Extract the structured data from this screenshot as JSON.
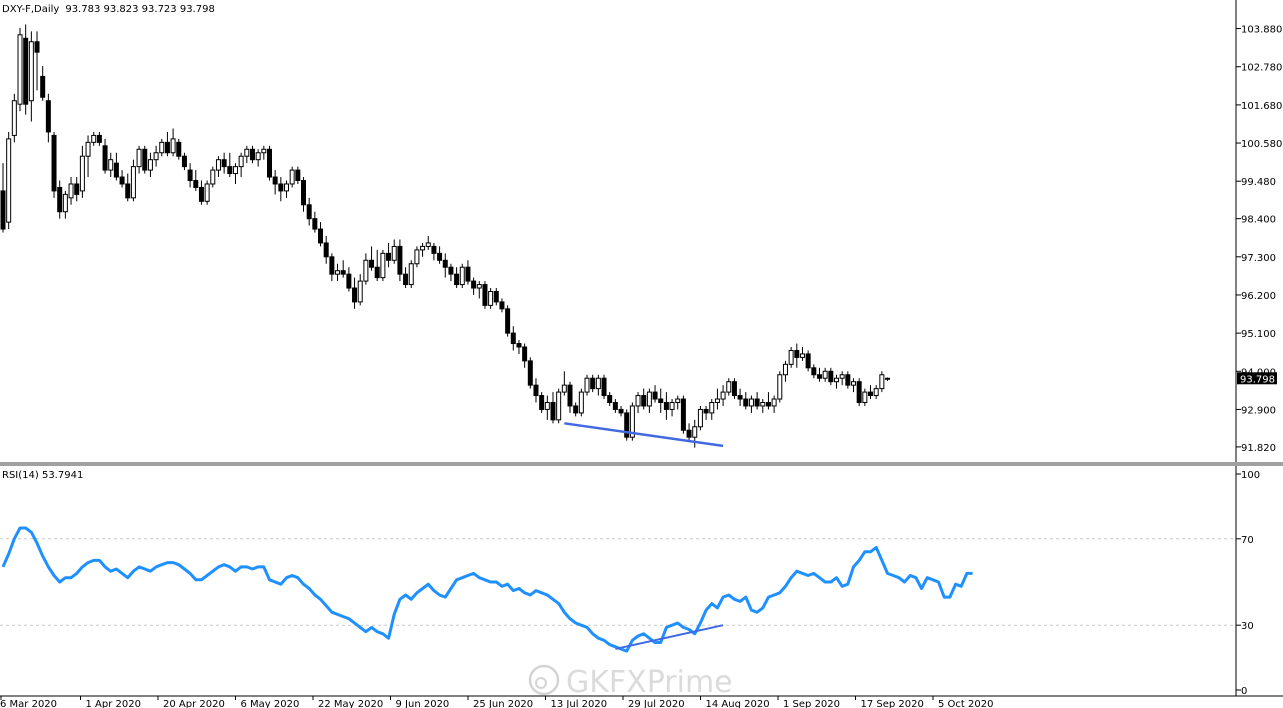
{
  "chart_data": [
    {
      "type": "candlestick",
      "title": "DXY-F,Daily",
      "ohlc_readout": "93.783 93.823 93.723 93.798",
      "symbol": "DXY-F",
      "timeframe": "Daily",
      "last_price_label": "93.798",
      "ylim": [
        91.5,
        104.3
      ],
      "yticks": [
        "103.880",
        "102.780",
        "101.680",
        "100.580",
        "99.480",
        "98.400",
        "97.300",
        "96.200",
        "95.100",
        "94.000",
        "92.900",
        "91.820"
      ],
      "xlabels": [
        "6 Mar 2020",
        "1 Apr 2020",
        "20 Apr 2020",
        "6 May 2020",
        "22 May 2020",
        "9 Jun 2020",
        "25 Jun 2020",
        "13 Jul 2020",
        "29 Jul 2020",
        "14 Aug 2020",
        "1 Sep 2020",
        "17 Sep 2020",
        "5 Oct 2020"
      ],
      "trendline": {
        "start_bar": 99,
        "start_price": 92.5,
        "end_bar": 127,
        "end_price": 91.85,
        "color": "#4169e1"
      },
      "candles": [
        [
          99.2,
          100.0,
          98.0,
          98.1
        ],
        [
          98.3,
          100.9,
          98.1,
          100.7
        ],
        [
          100.8,
          102.0,
          100.6,
          101.8
        ],
        [
          101.7,
          103.9,
          101.5,
          103.7
        ],
        [
          103.6,
          104.0,
          101.4,
          101.7
        ],
        [
          101.8,
          103.8,
          101.2,
          103.5
        ],
        [
          103.5,
          103.8,
          102.1,
          103.2
        ],
        [
          102.5,
          102.8,
          101.8,
          101.9
        ],
        [
          101.8,
          102.0,
          100.6,
          100.9
        ],
        [
          100.8,
          100.9,
          99.0,
          99.2
        ],
        [
          99.3,
          99.5,
          98.4,
          98.6
        ],
        [
          98.6,
          99.2,
          98.4,
          99.1
        ],
        [
          99.0,
          99.6,
          98.8,
          99.4
        ],
        [
          99.4,
          99.6,
          98.9,
          99.1
        ],
        [
          99.2,
          100.5,
          99.0,
          100.2
        ],
        [
          100.2,
          100.8,
          99.6,
          100.6
        ],
        [
          100.6,
          100.9,
          100.5,
          100.8
        ],
        [
          100.8,
          100.9,
          100.5,
          100.6
        ],
        [
          100.5,
          100.7,
          99.7,
          99.8
        ],
        [
          99.8,
          100.3,
          99.6,
          100.1
        ],
        [
          100.0,
          100.3,
          99.5,
          99.6
        ],
        [
          99.6,
          99.8,
          99.3,
          99.4
        ],
        [
          99.4,
          99.7,
          98.9,
          99.0
        ],
        [
          99.0,
          100.1,
          98.9,
          99.9
        ],
        [
          99.9,
          100.5,
          99.7,
          100.4
        ],
        [
          100.4,
          100.5,
          99.7,
          99.8
        ],
        [
          99.8,
          100.3,
          99.6,
          100.1
        ],
        [
          100.1,
          100.5,
          99.9,
          100.3
        ],
        [
          100.3,
          100.7,
          100.2,
          100.6
        ],
        [
          100.6,
          100.9,
          100.2,
          100.3
        ],
        [
          100.3,
          101.0,
          100.2,
          100.7
        ],
        [
          100.6,
          100.7,
          100.1,
          100.2
        ],
        [
          100.2,
          100.3,
          99.8,
          99.9
        ],
        [
          99.8,
          100.0,
          99.3,
          99.5
        ],
        [
          99.5,
          99.8,
          99.2,
          99.3
        ],
        [
          99.3,
          99.5,
          98.8,
          98.9
        ],
        [
          98.9,
          99.5,
          98.8,
          99.4
        ],
        [
          99.4,
          99.9,
          99.3,
          99.8
        ],
        [
          99.8,
          100.2,
          99.6,
          100.1
        ],
        [
          100.1,
          100.3,
          99.7,
          99.9
        ],
        [
          99.9,
          100.3,
          99.6,
          99.7
        ],
        [
          99.7,
          100.0,
          99.4,
          99.9
        ],
        [
          99.9,
          100.3,
          99.6,
          100.2
        ],
        [
          100.2,
          100.5,
          100.0,
          100.4
        ],
        [
          100.4,
          100.5,
          100.0,
          100.1
        ],
        [
          100.1,
          100.4,
          99.9,
          100.3
        ],
        [
          100.3,
          100.5,
          100.1,
          100.4
        ],
        [
          100.4,
          100.5,
          99.5,
          99.6
        ],
        [
          99.6,
          99.8,
          99.1,
          99.4
        ],
        [
          99.4,
          99.6,
          98.9,
          99.2
        ],
        [
          99.2,
          99.5,
          99.0,
          99.4
        ],
        [
          99.4,
          99.9,
          99.3,
          99.8
        ],
        [
          99.8,
          99.9,
          99.4,
          99.5
        ],
        [
          99.5,
          99.6,
          98.6,
          98.8
        ],
        [
          98.8,
          99.0,
          98.2,
          98.4
        ],
        [
          98.4,
          98.6,
          98.0,
          98.1
        ],
        [
          98.1,
          98.3,
          97.6,
          97.7
        ],
        [
          97.7,
          97.9,
          97.1,
          97.3
        ],
        [
          97.3,
          97.4,
          96.6,
          96.8
        ],
        [
          96.8,
          97.1,
          96.6,
          96.9
        ],
        [
          96.9,
          97.2,
          96.7,
          96.8
        ],
        [
          96.8,
          97.0,
          96.3,
          96.4
        ],
        [
          96.4,
          96.7,
          95.8,
          96.0
        ],
        [
          96.0,
          96.8,
          95.9,
          96.6
        ],
        [
          96.6,
          97.4,
          96.5,
          97.2
        ],
        [
          97.2,
          97.6,
          96.9,
          97.0
        ],
        [
          97.0,
          97.5,
          96.6,
          96.7
        ],
        [
          96.7,
          97.5,
          96.6,
          97.4
        ],
        [
          97.4,
          97.7,
          97.0,
          97.2
        ],
        [
          97.2,
          97.8,
          97.1,
          97.6
        ],
        [
          97.6,
          97.8,
          96.6,
          96.8
        ],
        [
          96.8,
          97.0,
          96.4,
          96.5
        ],
        [
          96.5,
          97.2,
          96.4,
          97.1
        ],
        [
          97.1,
          97.6,
          97.0,
          97.5
        ],
        [
          97.5,
          97.7,
          97.3,
          97.6
        ],
        [
          97.6,
          97.9,
          97.5,
          97.7
        ],
        [
          97.6,
          97.7,
          97.2,
          97.4
        ],
        [
          97.4,
          97.6,
          97.1,
          97.2
        ],
        [
          97.2,
          97.4,
          96.7,
          97.0
        ],
        [
          97.0,
          97.1,
          96.6,
          96.8
        ],
        [
          96.8,
          97.0,
          96.4,
          96.5
        ],
        [
          96.5,
          97.1,
          96.4,
          97.0
        ],
        [
          97.0,
          97.2,
          96.5,
          96.6
        ],
        [
          96.6,
          96.7,
          96.2,
          96.4
        ],
        [
          96.4,
          96.6,
          96.1,
          96.5
        ],
        [
          96.5,
          96.6,
          95.8,
          95.9
        ],
        [
          95.9,
          96.4,
          95.8,
          96.3
        ],
        [
          96.3,
          96.4,
          95.9,
          96.0
        ],
        [
          96.0,
          96.1,
          95.7,
          95.8
        ],
        [
          95.8,
          95.9,
          95.0,
          95.1
        ],
        [
          95.1,
          95.3,
          94.6,
          94.8
        ],
        [
          94.8,
          94.9,
          94.5,
          94.7
        ],
        [
          94.7,
          94.8,
          94.1,
          94.3
        ],
        [
          94.3,
          94.4,
          93.5,
          93.6
        ],
        [
          93.6,
          93.8,
          93.1,
          93.3
        ],
        [
          93.3,
          93.4,
          92.8,
          92.9
        ],
        [
          92.9,
          93.3,
          92.6,
          93.1
        ],
        [
          93.1,
          93.4,
          92.5,
          92.6
        ],
        [
          92.6,
          93.5,
          92.5,
          93.4
        ],
        [
          93.4,
          94.0,
          93.3,
          93.6
        ],
        [
          93.6,
          93.7,
          92.8,
          93.0
        ],
        [
          93.0,
          93.1,
          92.7,
          92.8
        ],
        [
          92.8,
          93.5,
          92.7,
          93.4
        ],
        [
          93.4,
          93.9,
          93.3,
          93.8
        ],
        [
          93.8,
          93.9,
          93.4,
          93.5
        ],
        [
          93.5,
          93.9,
          93.3,
          93.8
        ],
        [
          93.8,
          93.9,
          93.2,
          93.3
        ],
        [
          93.3,
          93.4,
          93.0,
          93.1
        ],
        [
          93.1,
          93.2,
          92.8,
          92.9
        ],
        [
          92.9,
          93.0,
          92.7,
          92.8
        ],
        [
          92.8,
          92.9,
          92.0,
          92.1
        ],
        [
          92.1,
          93.1,
          92.0,
          93.0
        ],
        [
          93.0,
          93.4,
          92.8,
          93.3
        ],
        [
          93.3,
          93.5,
          92.9,
          93.0
        ],
        [
          93.0,
          93.5,
          92.8,
          93.4
        ],
        [
          93.4,
          93.6,
          93.1,
          93.2
        ],
        [
          93.2,
          93.5,
          92.8,
          93.1
        ],
        [
          93.1,
          93.4,
          92.6,
          92.9
        ],
        [
          92.9,
          93.2,
          92.7,
          93.1
        ],
        [
          93.1,
          93.3,
          92.9,
          93.2
        ],
        [
          93.2,
          93.3,
          92.2,
          92.3
        ],
        [
          92.3,
          92.5,
          92.0,
          92.1
        ],
        [
          92.1,
          92.6,
          91.8,
          92.4
        ],
        [
          92.4,
          93.0,
          92.3,
          92.9
        ],
        [
          92.9,
          93.0,
          92.6,
          92.8
        ],
        [
          92.8,
          93.2,
          92.6,
          93.1
        ],
        [
          93.1,
          93.5,
          92.9,
          93.2
        ],
        [
          93.2,
          93.6,
          93.0,
          93.4
        ],
        [
          93.4,
          93.8,
          93.3,
          93.7
        ],
        [
          93.7,
          93.8,
          93.2,
          93.3
        ],
        [
          93.3,
          93.5,
          93.0,
          93.2
        ],
        [
          93.2,
          93.4,
          92.9,
          93.0
        ],
        [
          93.0,
          93.3,
          92.8,
          93.2
        ],
        [
          93.2,
          93.4,
          92.9,
          93.0
        ],
        [
          93.0,
          93.2,
          92.8,
          93.1
        ],
        [
          93.1,
          93.4,
          92.9,
          93.0
        ],
        [
          93.0,
          93.3,
          92.8,
          93.2
        ],
        [
          93.2,
          94.0,
          93.1,
          93.9
        ],
        [
          93.9,
          94.3,
          93.7,
          94.2
        ],
        [
          94.2,
          94.7,
          94.1,
          94.6
        ],
        [
          94.6,
          94.8,
          94.1,
          94.4
        ],
        [
          94.4,
          94.7,
          94.3,
          94.5
        ],
        [
          94.5,
          94.6,
          94.0,
          94.1
        ],
        [
          94.1,
          94.2,
          93.8,
          93.9
        ],
        [
          93.9,
          94.1,
          93.7,
          93.8
        ],
        [
          93.8,
          94.1,
          93.7,
          94.0
        ],
        [
          94.0,
          94.1,
          93.6,
          93.7
        ],
        [
          93.7,
          93.9,
          93.5,
          93.8
        ],
        [
          93.8,
          94.0,
          93.6,
          93.9
        ],
        [
          93.9,
          94.0,
          93.5,
          93.6
        ],
        [
          93.6,
          93.8,
          93.4,
          93.7
        ],
        [
          93.7,
          93.8,
          93.0,
          93.1
        ],
        [
          93.1,
          93.5,
          93.0,
          93.4
        ],
        [
          93.4,
          93.6,
          93.2,
          93.3
        ],
        [
          93.3,
          93.6,
          93.2,
          93.5
        ],
        [
          93.5,
          94.0,
          93.4,
          93.9
        ],
        [
          93.783,
          93.823,
          93.723,
          93.798
        ]
      ]
    },
    {
      "type": "line",
      "title": "RSI(14) 53.7941",
      "indicator": "RSI(14)",
      "last_value": 53.7941,
      "ylim": [
        0,
        100
      ],
      "yticks": [
        "100",
        "70",
        "30",
        "0"
      ],
      "levels": [
        70,
        30
      ],
      "series": [
        {
          "name": "RSI(14)",
          "color": "#1e90ff",
          "values": [
            57,
            63,
            70,
            75,
            75,
            73,
            68,
            62,
            57,
            53,
            50,
            52,
            52,
            54,
            57,
            59,
            60,
            60,
            57,
            55,
            56,
            54,
            52,
            55,
            57,
            56,
            55,
            57,
            58,
            59,
            59,
            58,
            56,
            54,
            51,
            51,
            53,
            55,
            57,
            58,
            57,
            55,
            57,
            57,
            56,
            57,
            57,
            51,
            50,
            49,
            52,
            53,
            52,
            49,
            47,
            44,
            42,
            39,
            36,
            35,
            34,
            33,
            31,
            29,
            27,
            29,
            27,
            26,
            24,
            35,
            42,
            44,
            42,
            45,
            47,
            49,
            46,
            44,
            43,
            47,
            51,
            52,
            53,
            54,
            52,
            51,
            50,
            50,
            48,
            49,
            46,
            47,
            45,
            44,
            46,
            45,
            44,
            42,
            40,
            36,
            33,
            31,
            30,
            29,
            26,
            24,
            23,
            21,
            20,
            19,
            18,
            23,
            25,
            26,
            24,
            22,
            22,
            29,
            30,
            31,
            29,
            28,
            26,
            31,
            37,
            40,
            38,
            43,
            44,
            42,
            41,
            43,
            37,
            36,
            38,
            43,
            44,
            45,
            48,
            52,
            55,
            54,
            53,
            54,
            52,
            50,
            50,
            52,
            48,
            49,
            57,
            60,
            64,
            64,
            66,
            60,
            54,
            53,
            52,
            50,
            53,
            52,
            47,
            52,
            51,
            50,
            43,
            43,
            49,
            48,
            54,
            54
          ]
        }
      ],
      "trendline": {
        "start_bar": 108,
        "start_value": 19,
        "end_bar": 127,
        "end_value": 30,
        "color": "#4169e1"
      }
    }
  ],
  "watermark": "GKFXPrime"
}
